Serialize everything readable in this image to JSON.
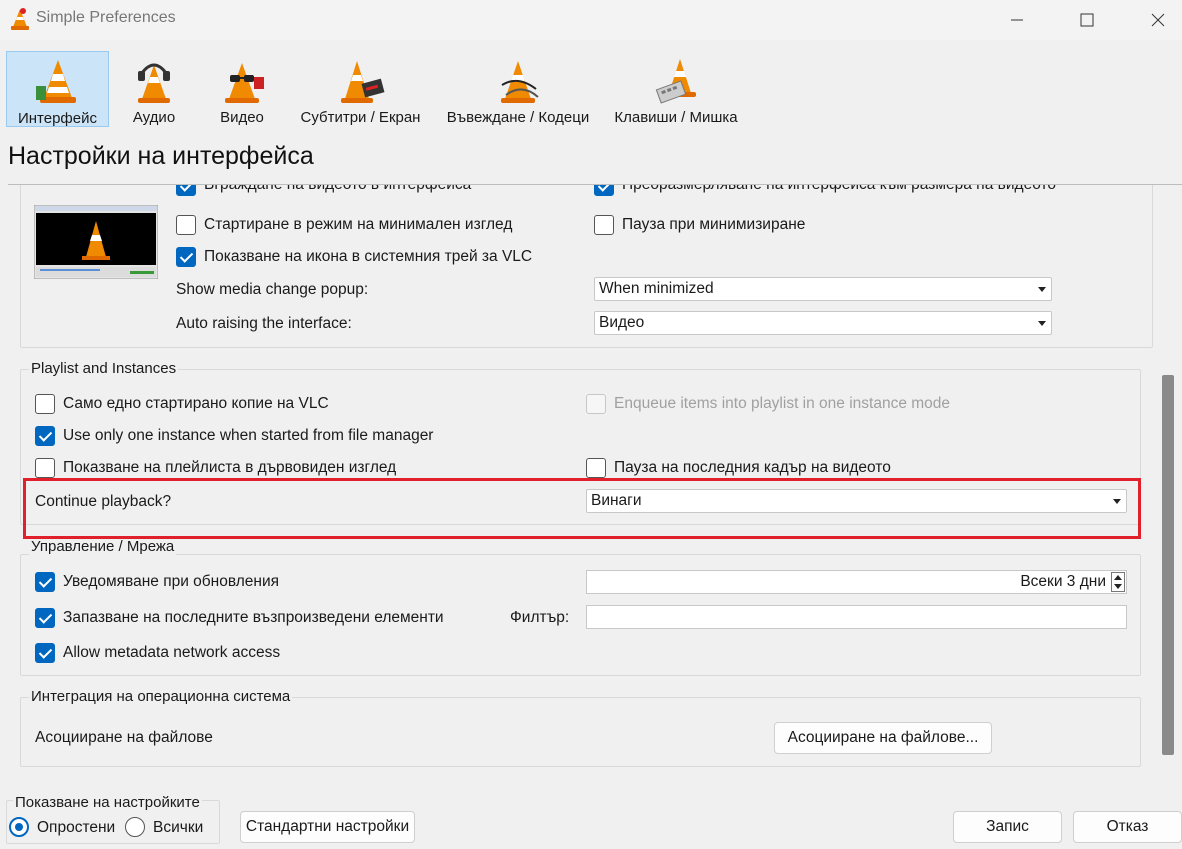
{
  "window": {
    "title": "Simple Preferences"
  },
  "tabs": [
    {
      "label": "Интерфейс",
      "icon": "vlc-cone-interface-icon",
      "active": true
    },
    {
      "label": "Аудио",
      "icon": "vlc-cone-headphones-icon",
      "active": false
    },
    {
      "label": "Видео",
      "icon": "vlc-cone-glasses-icon",
      "active": false
    },
    {
      "label": "Субтитри / Екран",
      "icon": "vlc-cone-subtitles-icon",
      "active": false
    },
    {
      "label": "Въвеждане / Кодеци",
      "icon": "vlc-cone-cables-icon",
      "active": false
    },
    {
      "label": "Клавиши / Мишка",
      "icon": "vlc-cone-keyboard-icon",
      "active": false
    }
  ],
  "page_title": "Настройки на интерфейса",
  "top_section": {
    "cut_left": "Вграждане на видеото в интерфейса",
    "cut_right": "Преоразмерляване на интерфейса към размера на видеото",
    "minimal_view": {
      "label": "Стартиране в режим на минимален изглед",
      "checked": false
    },
    "pause_minimize": {
      "label": "Пауза при минимизиране",
      "checked": false
    },
    "systray": {
      "label": "Показване на икона в системния трей за VLC",
      "checked": true
    },
    "media_popup": {
      "label": "Show media change popup:",
      "value": "When minimized"
    },
    "auto_raise": {
      "label": "Auto raising the interface:",
      "value": "Видео"
    }
  },
  "playlist_group": {
    "title": "Playlist and Instances",
    "one_instance": {
      "label": "Само едно стартирано копие на VLC",
      "checked": false
    },
    "enqueue": {
      "label": "Enqueue items into playlist in one instance mode",
      "checked": false,
      "disabled": true
    },
    "file_manager": {
      "label": "Use only one instance when started from file manager",
      "checked": true
    },
    "tree_view": {
      "label": "Показване на плейлиста в дървовиден изглед",
      "checked": false
    },
    "pause_last": {
      "label": "Пауза на последния кадър на видеото",
      "checked": false
    },
    "continue_playback": {
      "label": "Continue playback?",
      "value": "Винаги"
    }
  },
  "network_group": {
    "title": "Управление / Мрежа",
    "updates": {
      "label": "Уведомяване при обновления",
      "checked": true,
      "value": "Всеки 3 дни"
    },
    "recent": {
      "label": "Запазване на последните възпроизведени елементи",
      "checked": true
    },
    "filter_label": "Филтър:",
    "filter_value": "",
    "metadata": {
      "label": "Allow metadata network access",
      "checked": true
    }
  },
  "os_group": {
    "title": "Интеграция на операционна система",
    "assoc_label": "Асоцииране на файлове",
    "assoc_button": "Асоцииране на файлове..."
  },
  "footer": {
    "show_settings": "Показване на настройките",
    "simple": "Опростени",
    "all": "Всички",
    "reset": "Стандартни настройки",
    "save": "Запис",
    "cancel": "Отказ"
  },
  "colors": {
    "accent": "#0067c0",
    "highlight_border": "#e0202a",
    "selected_tab": "#cce4f7"
  }
}
